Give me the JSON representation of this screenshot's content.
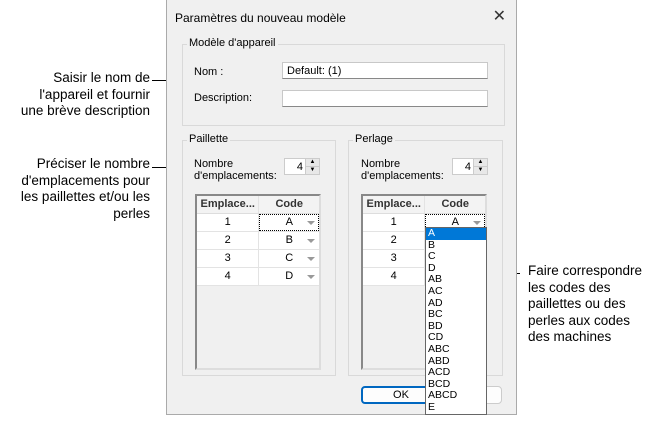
{
  "annotations": {
    "name_desc": [
      "Saisir le nom de",
      "l'appareil et fournir",
      "une brève description"
    ],
    "count": [
      "Préciser le nombre",
      "d'emplacements pour",
      "les paillettes et/ou les",
      "perles"
    ],
    "codes": [
      "Faire correspondre",
      "les codes des",
      "paillettes ou des",
      "perles aux codes",
      "des machines"
    ]
  },
  "dialog": {
    "title": "Paramètres du nouveau modèle",
    "close_icon": "close-icon",
    "model_group": {
      "label": "Modèle d'appareil",
      "name_label": "Nom :",
      "name_value": "Default: (1)",
      "desc_label": "Description:",
      "desc_value": ""
    },
    "sequin": {
      "label": "Paillette",
      "count_label_1": "Nombre",
      "count_label_2": "d'emplacements:",
      "count": "4",
      "headers": [
        "Emplace...",
        "Code"
      ],
      "rows": [
        {
          "slot": "1",
          "code": "A"
        },
        {
          "slot": "2",
          "code": "B"
        },
        {
          "slot": "3",
          "code": "C"
        },
        {
          "slot": "4",
          "code": "D"
        }
      ]
    },
    "bead": {
      "label": "Perlage",
      "count_label_1": "Nombre",
      "count_label_2": "d'emplacements:",
      "count": "4",
      "headers": [
        "Emplace...",
        "Code"
      ],
      "rows": [
        {
          "slot": "1",
          "code": "A"
        },
        {
          "slot": "2",
          "code": ""
        },
        {
          "slot": "3",
          "code": ""
        },
        {
          "slot": "4",
          "code": ""
        }
      ]
    },
    "dropdown_options": [
      "A",
      "B",
      "C",
      "D",
      "AB",
      "AC",
      "AD",
      "BC",
      "BD",
      "CD",
      "ABC",
      "ABD",
      "ACD",
      "BCD",
      "ABCD",
      "E"
    ],
    "dropdown_selected": "A",
    "ok_label": "OK"
  }
}
